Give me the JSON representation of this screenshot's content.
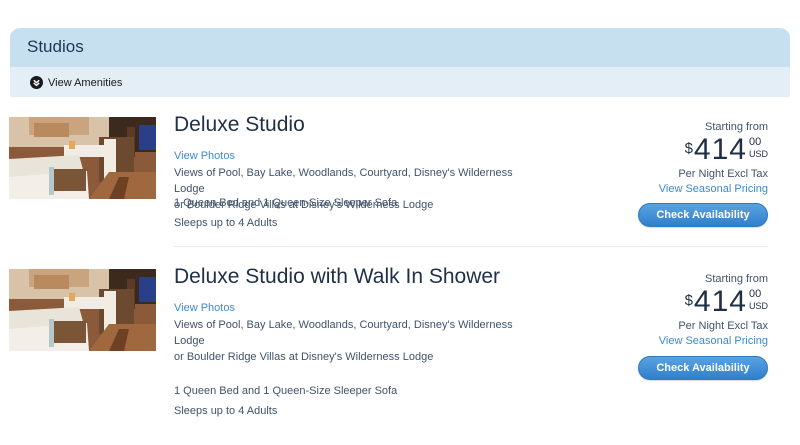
{
  "category": {
    "title": "Studios",
    "amenities_label": "View Amenities"
  },
  "rooms": [
    {
      "name": "Deluxe Studio",
      "view_photos": "View Photos",
      "view_line1": "Views of Pool, Bay Lake, Woodlands, Courtyard, Disney's Wilderness Lodge",
      "view_line2": "or Boulder Ridge Villas at Disney's Wilderness Lodge",
      "beds": "1 Queen Bed and 1 Queen-Size Sleeper Sofa",
      "sleeps": "Sleeps up to 4 Adults",
      "starting_from": "Starting from",
      "currency": "$",
      "price_whole": "414",
      "price_cents": "00",
      "price_unit": "USD",
      "per_night": "Per Night Excl Tax",
      "seasonal_link": "View Seasonal Pricing",
      "cta": "Check Availability"
    },
    {
      "name": "Deluxe Studio with Walk In Shower",
      "view_photos": "View Photos",
      "view_line1": "Views of Pool, Bay Lake, Woodlands, Courtyard, Disney's Wilderness Lodge",
      "view_line2": "or Boulder Ridge Villas at Disney's Wilderness Lodge",
      "beds": "1 Queen Bed and 1 Queen-Size Sleeper Sofa",
      "sleeps": "Sleeps up to 4 Adults",
      "starting_from": "Starting from",
      "currency": "$",
      "price_whole": "414",
      "price_cents": "00",
      "price_unit": "USD",
      "per_night": "Per Night Excl Tax",
      "seasonal_link": "View Seasonal Pricing",
      "cta": "Check Availability"
    }
  ],
  "colors": {
    "header_bg": "#c6e0f0",
    "amenities_bg": "#e4eef6",
    "link": "#3c8ad0",
    "button": "#2f7fcb",
    "text": "#1f2f45"
  }
}
